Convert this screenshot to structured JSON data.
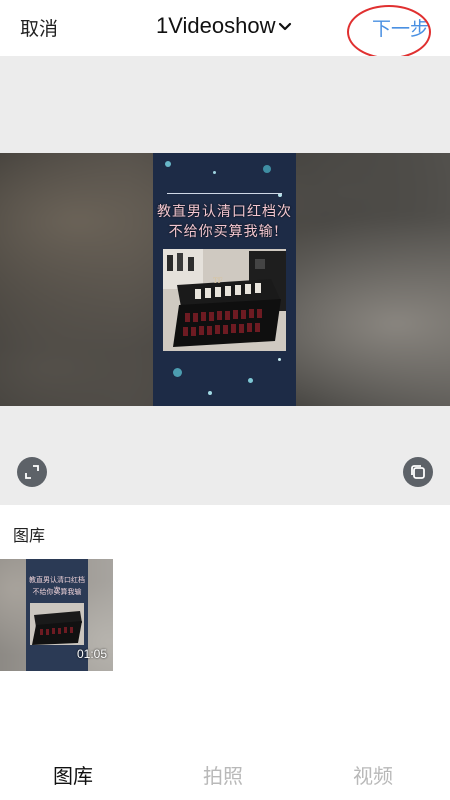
{
  "header": {
    "cancel_label": "取消",
    "title": "1Videoshow",
    "next_label": "下一步",
    "next_color": "#4a90e2",
    "annotation_color": "#e03030"
  },
  "preview": {
    "frame_text_line1": "教直男认清口红档次",
    "frame_text_line2": "不给你买算我输!",
    "photo_brand": "TF",
    "left_button_icon": "expand-icon",
    "right_button_icon": "copy-icon"
  },
  "gallery": {
    "label": "图库",
    "items": [
      {
        "text_line1": "教直男认清口红档次",
        "text_line2": "不给你买算我输",
        "duration": "01:05"
      }
    ]
  },
  "tabs": [
    {
      "label": "图库",
      "active": true
    },
    {
      "label": "拍照",
      "active": false
    },
    {
      "label": "视频",
      "active": false
    }
  ]
}
